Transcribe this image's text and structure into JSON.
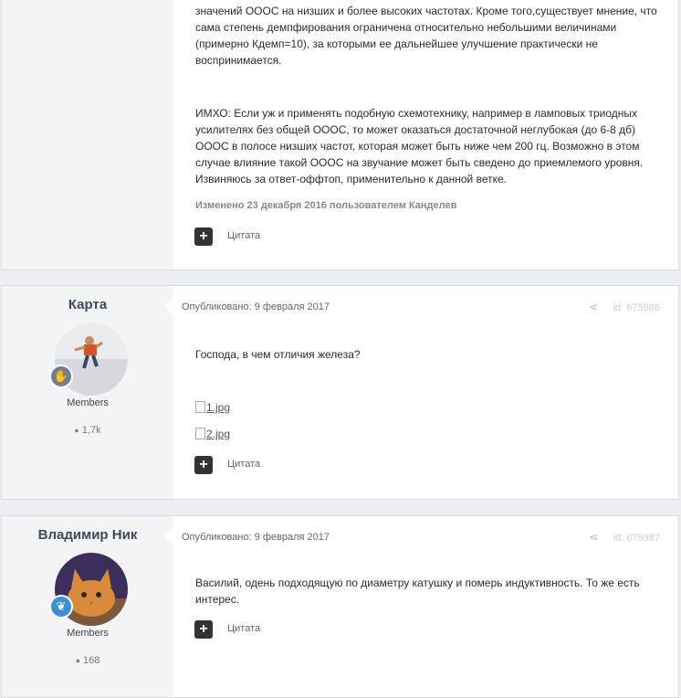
{
  "posts": [
    {
      "paragraphs": [
        "значений ОООС на низших и более высоких частотах. Кроме того,существует мнение, что сама степень демпфирования ограничена относительно небольшими величинами (примерно Кдемп=10), за которыми ее дальнейшее улучшение практически не воспринимается.",
        "ИМХО: Если уж и применять подобную схемотехнику, например в ламповых триодных усилителях без общей ОООС, то может оказаться достаточной неглубокая (до 6-8 дб) ОООС в полосе низших частот, которая может быть ниже чем 200 гц. Возможно в этом случае влияние такой ОООС на звучание может быть сведено до приемлемого уровня. Извиняюсь за ответ-оффтоп, применительно к данной ветке."
      ],
      "edited": "Изменено 23 декабря 2016 пользователем Канделев",
      "quote_label": "Цитата"
    },
    {
      "author": "Карта",
      "group": "Members",
      "post_count": "1,7k",
      "published": "Опубликовано: 9 февраля 2017",
      "post_id": "id: 675986",
      "text": "Господа, в чем отличия железа?",
      "images": [
        "1.jpg",
        "2.jpg"
      ],
      "quote_label": "Цитата",
      "badge_color": "#6f7f94"
    },
    {
      "author": "Владимир Ник",
      "group": "Members",
      "post_count": "168",
      "published": "Опубликовано: 9 февраля 2017",
      "post_id": "id: 675987",
      "text": "Василий, одень подходящую по диаметру катушку и померь индуктивность. То же есть интерес.",
      "quote_label": "Цитата",
      "badge_color": "#3b8fd6"
    }
  ]
}
